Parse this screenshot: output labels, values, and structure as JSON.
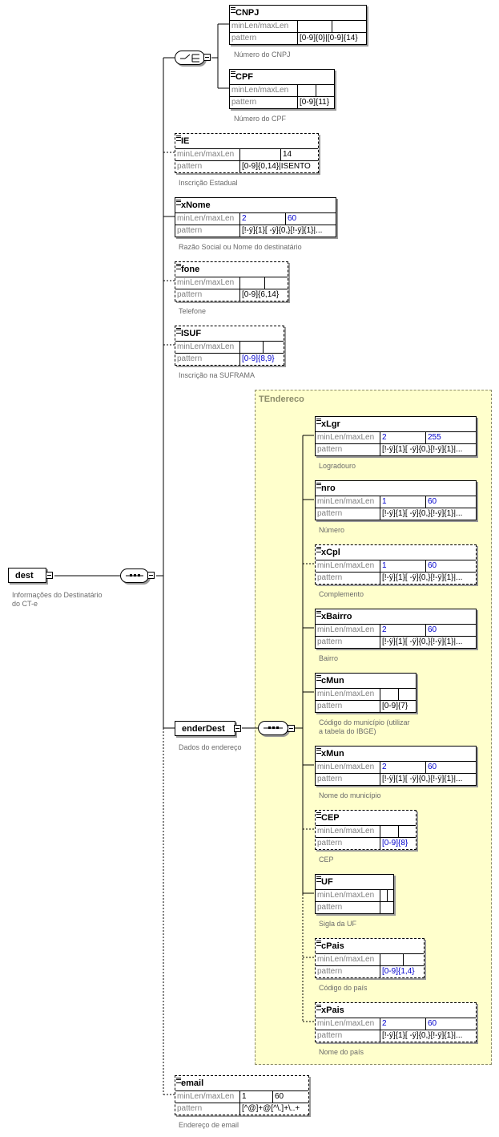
{
  "labels": {
    "minmax": "minLen/maxLen",
    "pattern": "pattern"
  },
  "root": {
    "name": "dest",
    "doc1": "Informações do Destinatário",
    "doc2": "do CT-e"
  },
  "type_name": "TEndereco",
  "nodes": {
    "cnpj": {
      "name": "CNPJ",
      "min": "",
      "max": "",
      "pattern": "[0-9]{0}|[0-9]{14}",
      "doc": "Número do CNPJ"
    },
    "cpf": {
      "name": "CPF",
      "min": "",
      "max": "",
      "pattern": "[0-9]{11}",
      "doc": "Número do CPF"
    },
    "ie": {
      "name": "IE",
      "min": "",
      "max": "14",
      "pattern": "[0-9]{0,14}|ISENTO",
      "doc": "Inscrição Estadual"
    },
    "xnome": {
      "name": "xNome",
      "min": "2",
      "max": "60",
      "pattern": "[!-ÿ]{1}[ -ÿ]{0,}[!-ÿ]{1}|...",
      "doc": "Razão Social ou Nome do destinatário"
    },
    "fone": {
      "name": "fone",
      "min": "",
      "max": "",
      "pattern": "[0-9]{6,14}",
      "doc": "Telefone"
    },
    "isuf": {
      "name": "ISUF",
      "min": "",
      "max": "",
      "pattern": "[0-9]{8,9}",
      "doc": "Inscrição na SUFRAMA"
    },
    "enderdest": {
      "name": "enderDest",
      "doc": "Dados do endereço"
    },
    "xlgr": {
      "name": "xLgr",
      "min": "2",
      "max": "255",
      "pattern": "[!-ÿ]{1}[ -ÿ]{0,}[!-ÿ]{1}|...",
      "doc": "Logradouro"
    },
    "nro": {
      "name": "nro",
      "min": "1",
      "max": "60",
      "pattern": "[!-ÿ]{1}[ -ÿ]{0,}[!-ÿ]{1}|...",
      "doc": "Número"
    },
    "xcpl": {
      "name": "xCpl",
      "min": "1",
      "max": "60",
      "pattern": "[!-ÿ]{1}[ -ÿ]{0,}[!-ÿ]{1}|...",
      "doc": "Complemento"
    },
    "xbairro": {
      "name": "xBairro",
      "min": "2",
      "max": "60",
      "pattern": "[!-ÿ]{1}[ -ÿ]{0,}[!-ÿ]{1}|...",
      "doc": "Bairro"
    },
    "cmun": {
      "name": "cMun",
      "min": "",
      "max": "",
      "pattern": "[0-9]{7}",
      "doc1": "Código do município (utilizar",
      "doc2": "a tabela do IBGE)"
    },
    "xmun": {
      "name": "xMun",
      "min": "2",
      "max": "60",
      "pattern": "[!-ÿ]{1}[ -ÿ]{0,}[!-ÿ]{1}|...",
      "doc": "Nome do município"
    },
    "cep": {
      "name": "CEP",
      "min": "",
      "max": "",
      "pattern": "[0-9]{8}",
      "doc": "CEP"
    },
    "uf": {
      "name": "UF",
      "min": "",
      "max": "",
      "pattern": "",
      "doc": "Sigla da UF"
    },
    "cpais": {
      "name": "cPais",
      "min": "",
      "max": "",
      "pattern": "[0-9]{1,4}",
      "doc": "Código do país"
    },
    "xpais": {
      "name": "xPais",
      "min": "2",
      "max": "60",
      "pattern": "[!-ÿ]{1}[ -ÿ]{0,}[!-ÿ]{1}|...",
      "doc": "Nome do país"
    },
    "email": {
      "name": "email",
      "min": "1",
      "max": "60",
      "pattern": "[^@]+@[^\\.]+\\..+",
      "doc": "Endereço de email"
    }
  },
  "colors": {
    "type_fill": "#ffffcc",
    "type_border": "#8c8c6a",
    "link": "#0000cc",
    "caption": "#6b6b6b"
  }
}
